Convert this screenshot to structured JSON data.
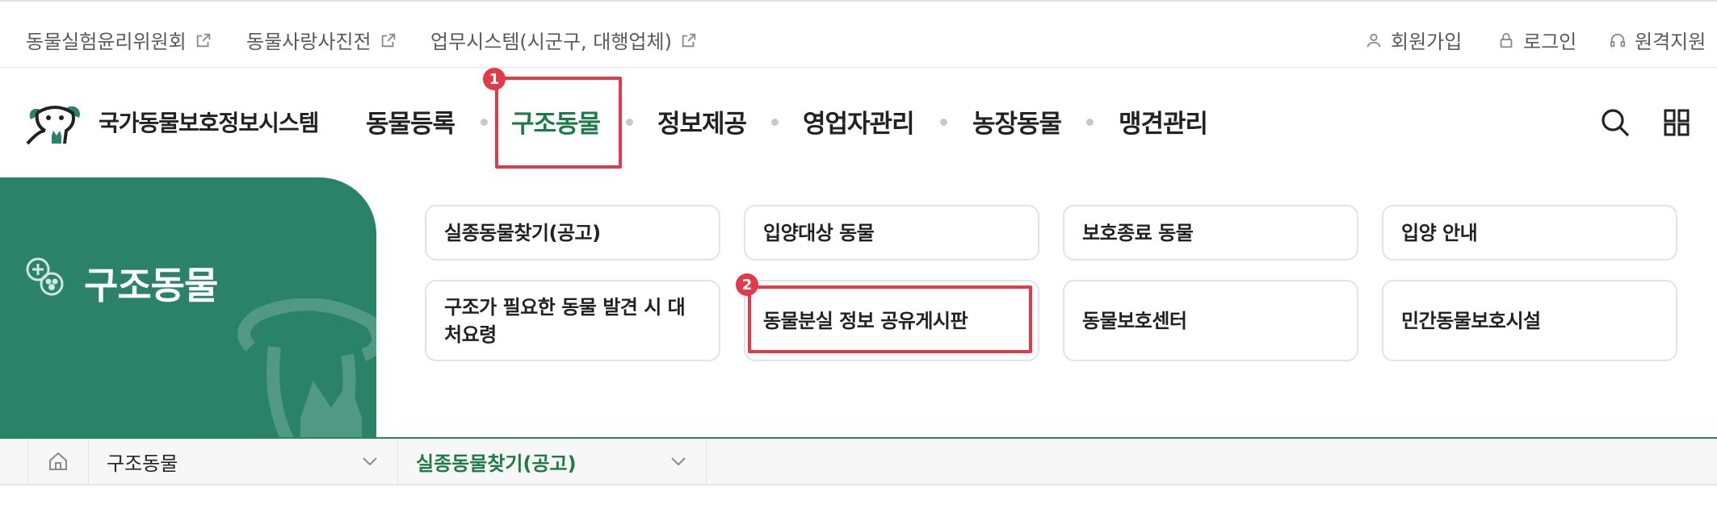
{
  "utility_links": [
    {
      "label": "동물실험윤리위원회",
      "external": true
    },
    {
      "label": "동물사랑사진전",
      "external": true
    },
    {
      "label": "업무시스템(시군구, 대행업체)",
      "external": true
    }
  ],
  "utility_right": {
    "signup": "회원가입",
    "login": "로그인",
    "remote": "원격지원"
  },
  "logo": {
    "text": "국가동물보호정보시스템"
  },
  "gnb": [
    {
      "label": "동물등록"
    },
    {
      "label": "구조동물",
      "active": true
    },
    {
      "label": "정보제공"
    },
    {
      "label": "영업자관리"
    },
    {
      "label": "농장동물"
    },
    {
      "label": "맹견관리"
    }
  ],
  "annotations": {
    "badge1": "1",
    "badge2": "2"
  },
  "panel": {
    "title": "구조동물"
  },
  "submenu": [
    {
      "label": "실종동물찾기(공고)"
    },
    {
      "label": "입양대상 동물"
    },
    {
      "label": "보호종료 동물"
    },
    {
      "label": "입양 안내"
    },
    {
      "label": "구조가 필요한 동물 발견 시 대처요령"
    },
    {
      "label": "동물분실 정보 공유게시판"
    },
    {
      "label": "동물보호센터"
    },
    {
      "label": "민간동물보호시설"
    }
  ],
  "breadcrumb": {
    "level1": "구조동물",
    "level2": "실종동물찾기(공고)"
  },
  "colors": {
    "brand_green": "#2a8369",
    "active_text": "#1f7a4a",
    "highlight_red": "#e23a4a"
  },
  "icons": {
    "external": "external-link-icon",
    "user": "user-icon",
    "lock": "lock-icon",
    "headset": "headset-icon",
    "search": "search-icon",
    "grid": "grid-menu-icon",
    "home": "home-icon",
    "chevron": "chevron-down-icon"
  }
}
